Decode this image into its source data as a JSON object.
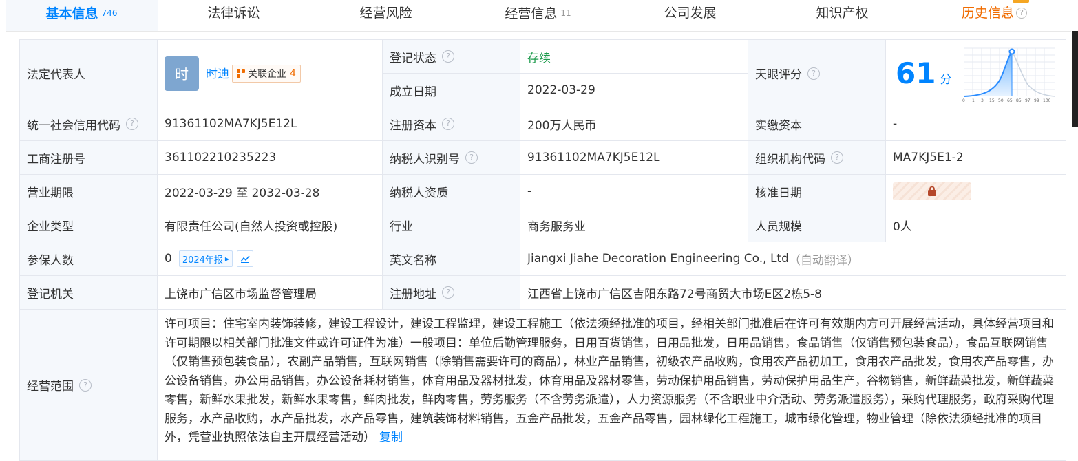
{
  "tabs": [
    {
      "label": "基本信息",
      "count": "746"
    },
    {
      "label": "法律诉讼",
      "count": ""
    },
    {
      "label": "经营风险",
      "count": ""
    },
    {
      "label": "经营信息",
      "count": "11"
    },
    {
      "label": "公司发展",
      "count": ""
    },
    {
      "label": "知识产权",
      "count": ""
    },
    {
      "label": "历史信息",
      "count": ""
    }
  ],
  "help_glyph": "?",
  "legal_rep": {
    "label": "法定代表人",
    "avatar_char": "时",
    "name": "时迪",
    "related_label": "关联企业",
    "related_count": "4"
  },
  "reg_status": {
    "label": "登记状态",
    "value": "存续"
  },
  "found_date": {
    "label": "成立日期",
    "value": "2022-03-29"
  },
  "tianyan_score": {
    "label": "天眼评分",
    "score": "61",
    "unit": "分",
    "axis_ticks": [
      "0",
      "1",
      "3",
      "15",
      "50",
      "65",
      "85",
      "97",
      "99",
      "100"
    ]
  },
  "rows": {
    "credit_code": {
      "label": "统一社会信用代码",
      "value": "91361102MA7KJ5E12L"
    },
    "reg_capital": {
      "label": "注册资本",
      "value": "200万人民币"
    },
    "paid_capital": {
      "label": "实缴资本",
      "value": "-"
    },
    "biz_reg_no": {
      "label": "工商注册号",
      "value": "361102210235223"
    },
    "taxpayer_id": {
      "label": "纳税人识别号",
      "value": "91361102MA7KJ5E12L"
    },
    "org_code": {
      "label": "组织机构代码",
      "value": "MA7KJ5E1-2"
    },
    "biz_term": {
      "label": "营业期限",
      "value": "2022-03-29 至 2032-03-28"
    },
    "taxpayer_qual": {
      "label": "纳税人资质",
      "value": "-"
    },
    "approval_date": {
      "label": "核准日期",
      "value": ""
    },
    "company_type": {
      "label": "企业类型",
      "value": "有限责任公司(自然人投资或控股)"
    },
    "industry": {
      "label": "行业",
      "value": "商务服务业"
    },
    "staff_size": {
      "label": "人员规模",
      "value": "0人"
    },
    "insured": {
      "label": "参保人数",
      "value": "0",
      "report_badge": "2024年报"
    },
    "english_name": {
      "label": "英文名称",
      "value": "Jiangxi Jiahe Decoration Engineering Co., Ltd",
      "note": "（自动翻译）"
    },
    "reg_authority": {
      "label": "登记机关",
      "value": "上饶市广信区市场监督管理局"
    },
    "reg_address": {
      "label": "注册地址",
      "value": "江西省上饶市广信区吉阳东路72号商贸大市场E区2栋5-8"
    }
  },
  "scope": {
    "label": "经营范围",
    "text": "许可项目：住宅室内装饰装修，建设工程设计，建设工程监理，建设工程施工（依法须经批准的项目，经相关部门批准后在许可有效期内方可开展经营活动，具体经营项目和许可期限以相关部门批准文件或许可证件为准）一般项目：单位后勤管理服务，日用百货销售，日用品批发，日用品销售，食品销售（仅销售预包装食品），食品互联网销售（仅销售预包装食品），农副产品销售，互联网销售（除销售需要许可的商品），林业产品销售，初级农产品收购，食用农产品初加工，食用农产品批发，食用农产品零售，办公设备销售，办公用品销售，办公设备耗材销售，体育用品及器材批发，体育用品及器材零售，劳动保护用品销售，劳动保护用品生产，谷物销售，新鲜蔬菜批发，新鲜蔬菜零售，新鲜水果批发，新鲜水果零售，鲜肉批发，鲜肉零售，劳务服务（不含劳务派遣），人力资源服务（不含职业中介活动、劳务派遣服务），采购代理服务，政府采购代理服务，水产品收购，水产品批发，水产品零售，建筑装饰材料销售，五金产品批发，五金产品零售，园林绿化工程施工，城市绿化管理，物业管理（除依法须经批准的项目外，凭营业执照依法自主开展经营活动）",
    "copy_label": "复制"
  },
  "colors": {
    "accent": "#0084ff",
    "status_green": "#1d9b4c",
    "history_orange": "#f06c00",
    "label_bg": "#f5f8fc"
  }
}
